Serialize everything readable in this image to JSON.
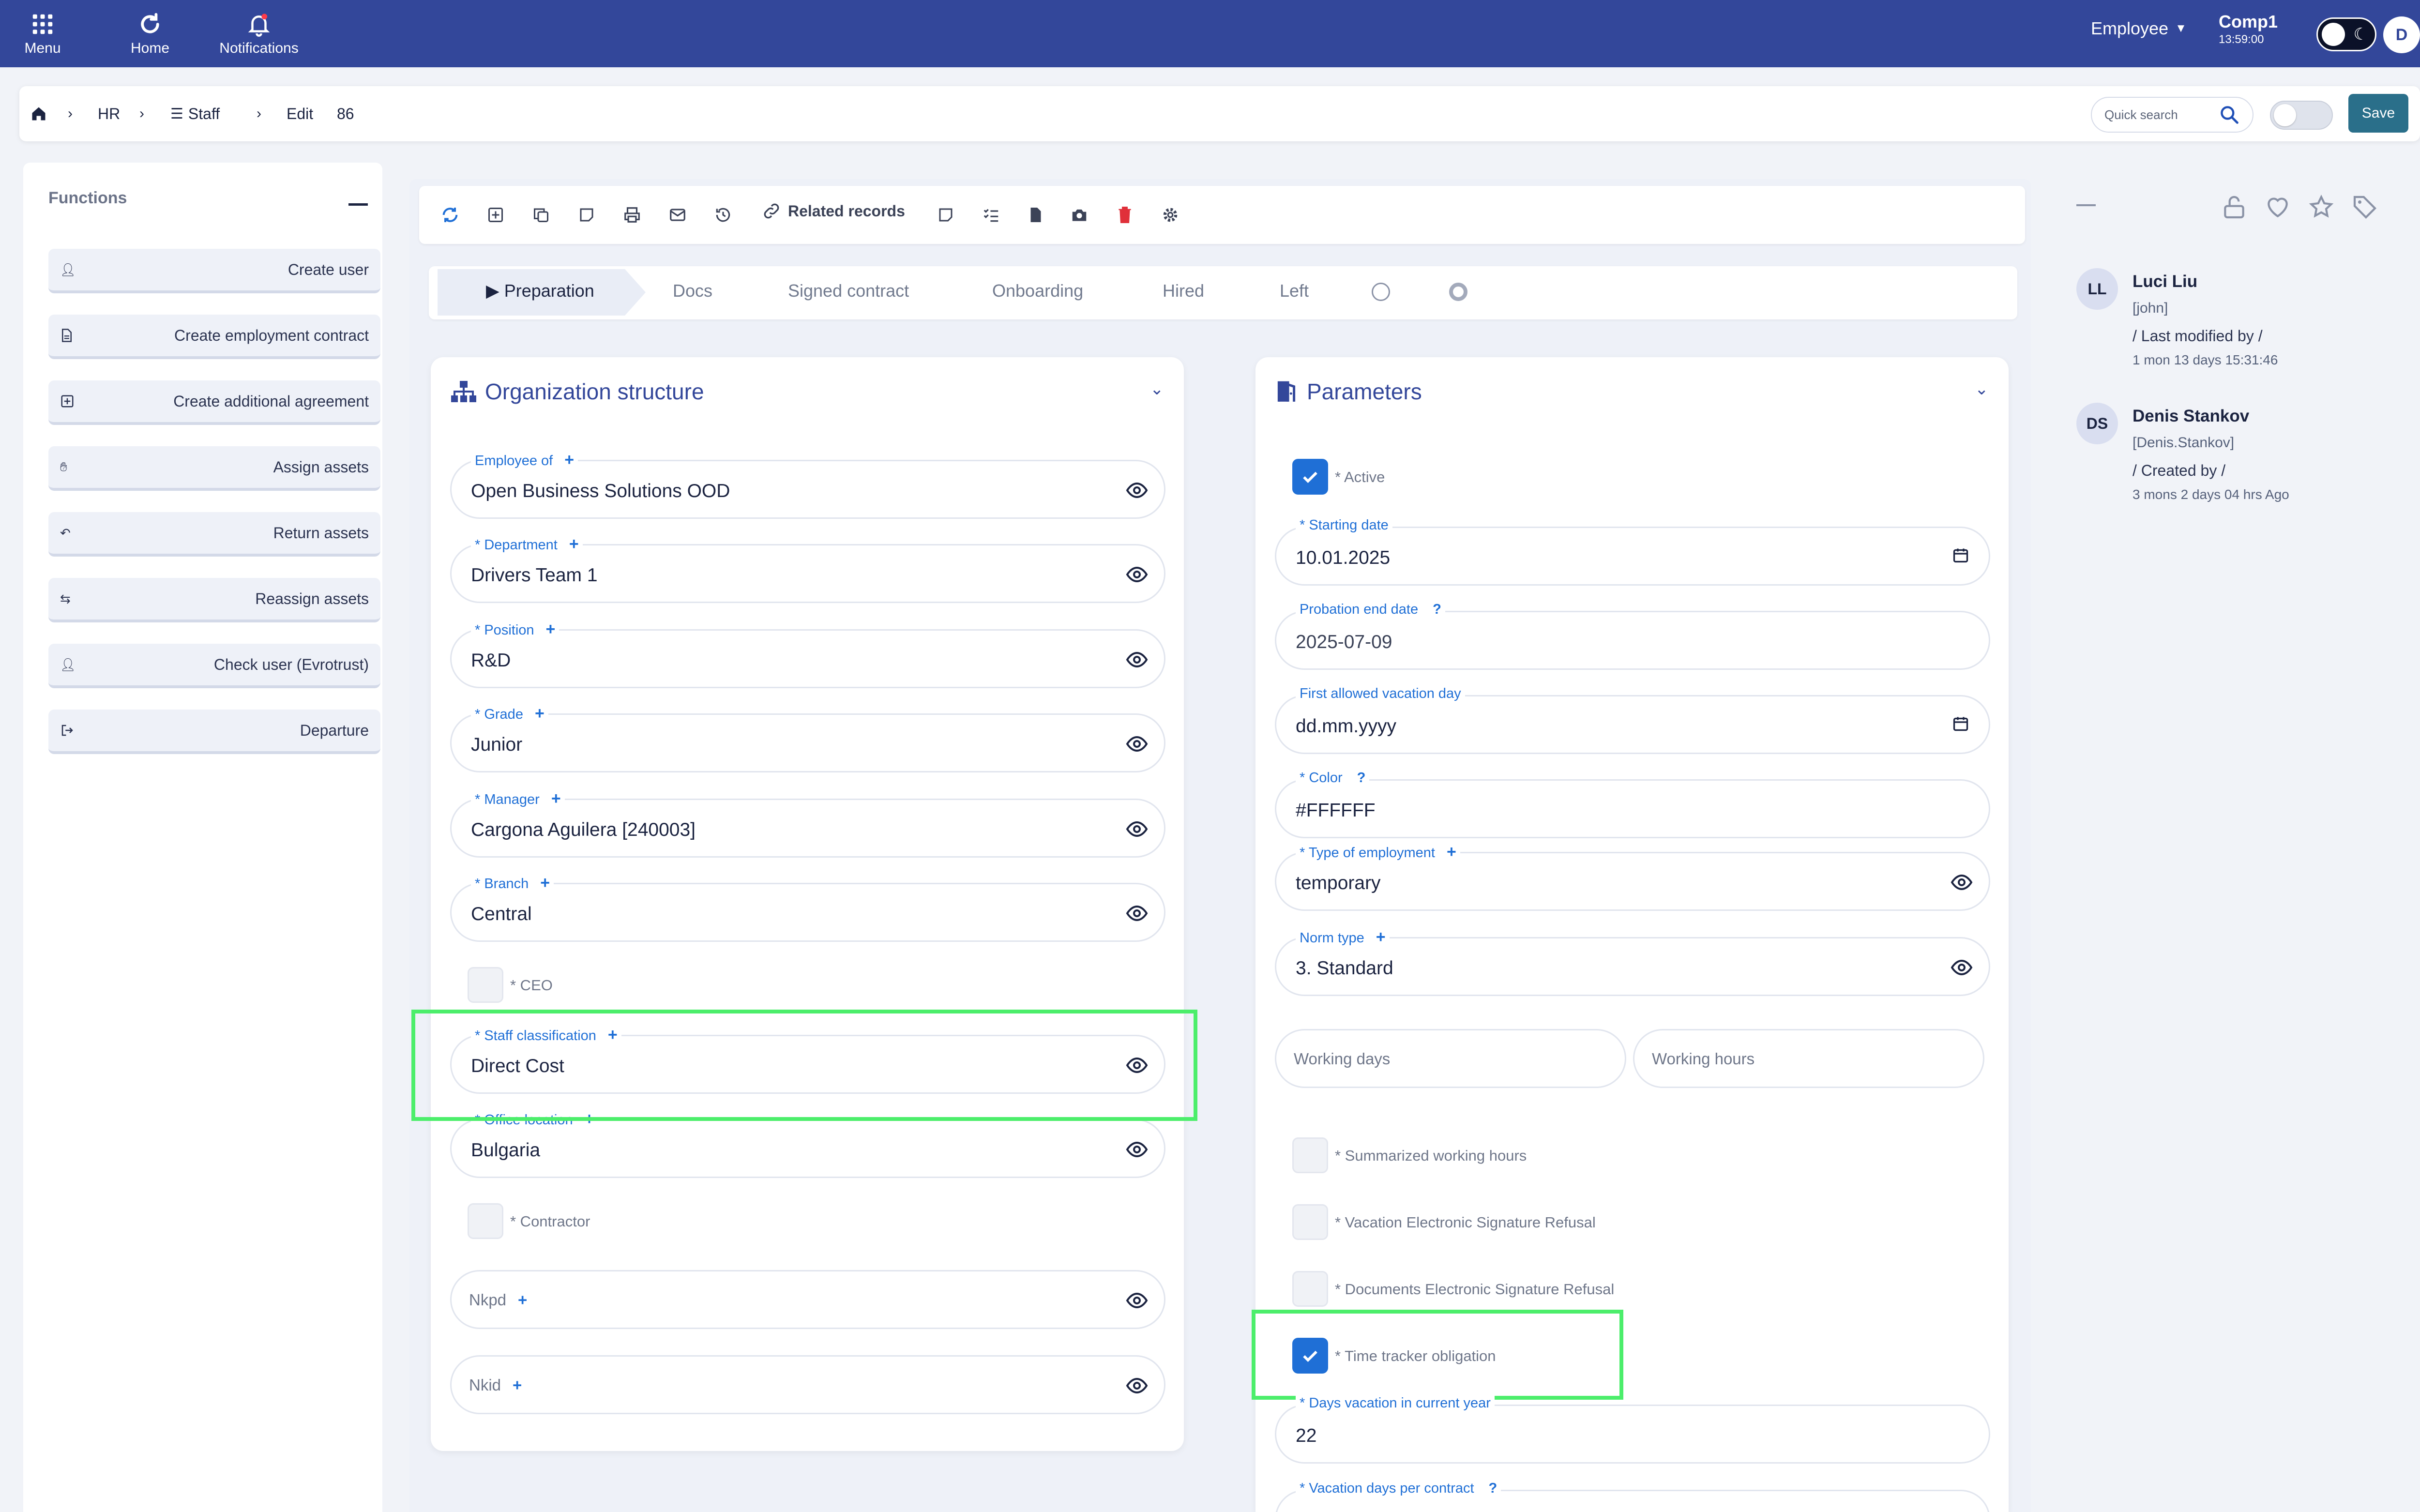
{
  "topbar": {
    "menu_label": "Menu",
    "home_label": "Home",
    "notifications_label": "Notifications",
    "role_select": "Employee",
    "company_name": "Comp1",
    "clock": "13:59:00",
    "user_initial": "D"
  },
  "breadcrumb": {
    "items": [
      "HR",
      "Staff",
      "Edit"
    ],
    "record_id": "86"
  },
  "header_actions": {
    "search_placeholder": "Quick search",
    "save_label": "Save"
  },
  "functions": {
    "title": "Functions",
    "items": [
      {
        "label": "Create user",
        "icon": "user-icon"
      },
      {
        "label": "Create employment contract",
        "icon": "document-icon"
      },
      {
        "label": "Create additional agreement",
        "icon": "plus-square-icon"
      },
      {
        "label": "Assign assets",
        "icon": "hand-icon"
      },
      {
        "label": "Return assets",
        "icon": "undo-icon"
      },
      {
        "label": "Reassign assets",
        "icon": "swap-icon"
      },
      {
        "label": "Check user (Evrotrust)",
        "icon": "user-icon"
      },
      {
        "label": "Departure",
        "icon": "exit-icon"
      }
    ]
  },
  "toolbar": {
    "related_records_label": "Related records"
  },
  "stages": {
    "items": [
      "Preparation",
      "Docs",
      "Signed contract",
      "Onboarding",
      "Hired",
      "Left"
    ],
    "active": "Preparation"
  },
  "org_structure": {
    "title": "Organization structure",
    "fields": {
      "employee_of": {
        "label": "Employee of",
        "value": "Open Business Solutions OOD"
      },
      "department": {
        "label": "* Department",
        "value": "Drivers Team 1"
      },
      "position": {
        "label": "* Position",
        "value": "R&D"
      },
      "grade": {
        "label": "* Grade",
        "value": "Junior"
      },
      "manager": {
        "label": "* Manager",
        "value": "Cargona Aguilera [240003]"
      },
      "branch": {
        "label": "* Branch",
        "value": "Central"
      },
      "ceo": {
        "label": "* CEO",
        "checked": false
      },
      "staff_classification": {
        "label": "* Staff classification",
        "value": "Direct Cost"
      },
      "office_location": {
        "label": "* Office location",
        "value": "Bulgaria"
      },
      "contractor": {
        "label": "* Contractor",
        "checked": false
      },
      "nkpd": {
        "placeholder": "Nkpd"
      },
      "nkid": {
        "placeholder": "Nkid"
      }
    }
  },
  "parameters": {
    "title": "Parameters",
    "fields": {
      "active": {
        "label": "* Active",
        "checked": true
      },
      "starting_date": {
        "label": "* Starting date",
        "value": "10.01.2025"
      },
      "probation_end": {
        "label": "Probation end date",
        "value": "2025-07-09"
      },
      "first_vacation_day": {
        "label": "First allowed vacation day",
        "value": "dd.mm.yyyy"
      },
      "color": {
        "label": "* Color",
        "value": "#FFFFFF"
      },
      "type_of_employment": {
        "label": "* Type of employment",
        "value": "temporary"
      },
      "norm_type": {
        "label": "Norm type",
        "value": "3. Standard"
      },
      "working_days": {
        "placeholder": "Working days"
      },
      "working_hours": {
        "placeholder": "Working hours"
      },
      "summarized_hours": {
        "label": "* Summarized working hours",
        "checked": false
      },
      "vacation_esig_refusal": {
        "label": "* Vacation Electronic Signature Refusal",
        "checked": false
      },
      "documents_esig_refusal": {
        "label": "* Documents Electronic Signature Refusal",
        "checked": false
      },
      "time_tracker": {
        "label": "* Time tracker obligation",
        "checked": true
      },
      "days_vacation_current": {
        "label": "* Days vacation in current year",
        "value": "22"
      },
      "vacation_days_contract": {
        "label": "* Vacation days per contract"
      }
    }
  },
  "activity": {
    "entries": [
      {
        "initials": "LL",
        "name": "Luci Liu",
        "login": "[john]",
        "action": "/ Last modified by /",
        "time": "1 mon 13 days 15:31:46"
      },
      {
        "initials": "DS",
        "name": "Denis Stankov",
        "login": "[Denis.Stankov]",
        "action": "/ Created by /",
        "time": "3 mons 2 days 04 hrs Ago"
      }
    ]
  },
  "colors": {
    "topbar": "#33479a",
    "accent_blue": "#1f6fd6",
    "save_button": "#2a6f8a",
    "highlight_box": "#4cee6b"
  }
}
